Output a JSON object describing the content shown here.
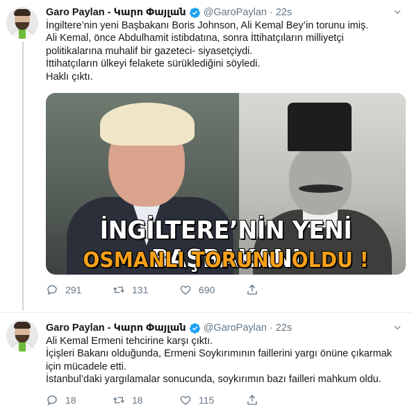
{
  "tweets": [
    {
      "author_name": "Garo Paylan - Կարո Փայլան",
      "handle": "@GaroPaylan",
      "separator": "·",
      "time": "22s",
      "lines": [
        "İngiltere’nin yeni Başbakanı Boris Johnson, Ali Kemal Bey’in torunu imiş.",
        "Ali Kemal, önce Abdulhamit istibdatına, sonra İttihatçıların milliyetçi",
        "politikalarına muhalif bir gazeteci- siyasetçiydi.",
        "İttihatçıların ülkeyi felakete sürüklediğini söyledi.",
        "Haklı çıktı."
      ],
      "media": {
        "headline": "İNGİLTERE’NİN YENİ BAŞBAKANI",
        "subheadline": "OSMANLI TORUNU OLDU !"
      },
      "actions": {
        "replies": "291",
        "retweets": "131",
        "likes": "690"
      }
    },
    {
      "author_name": "Garo Paylan - Կարո Փայլան",
      "handle": "@GaroPaylan",
      "separator": "·",
      "time": "22s",
      "lines": [
        "Ali Kemal Ermeni tehcirine karşı çıktı.",
        "İçişleri Bakanı olduğunda, Ermeni Soykırımının faillerini yargı önüne çıkarmak",
        "için mücadele etti.",
        "İstanbul’daki yargılamalar sonucunda, soykırımın bazı failleri mahkum oldu."
      ],
      "actions": {
        "replies": "18",
        "retweets": "18",
        "likes": "115"
      }
    }
  ],
  "colors": {
    "verified": "#1da1f2",
    "secondary_text": "#657786",
    "thread_line": "#ccd6dd",
    "headline_orange": "#f6a01a"
  },
  "icons": {
    "verified": "verified-badge-icon",
    "caret": "chevron-down-icon",
    "reply": "reply-icon",
    "retweet": "retweet-icon",
    "like": "heart-icon",
    "share": "share-icon"
  }
}
